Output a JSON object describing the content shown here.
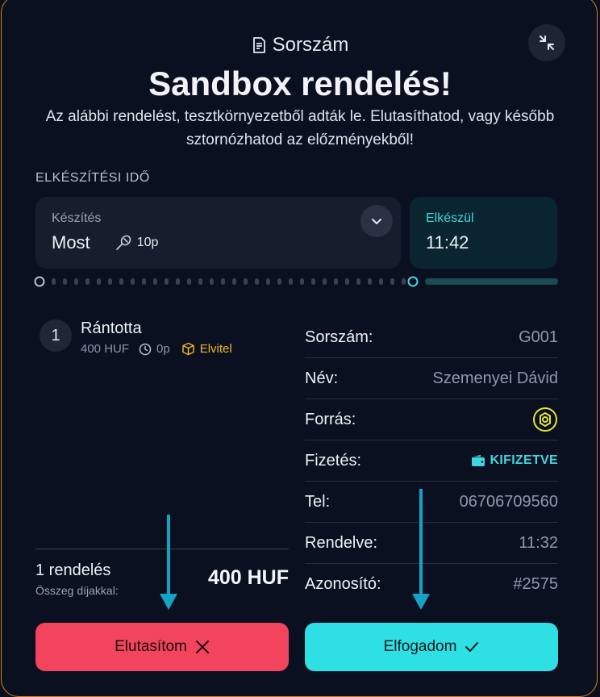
{
  "header": {
    "label": "Sorszám",
    "title": "Sandbox rendelés!",
    "subtitle": "Az alábbi rendelést, tesztkörnyezetből adták le. Elutasíthatod, vagy később sztornózhatod az előzményekből!"
  },
  "prep": {
    "section_label": "ELKÉSZÍTÉSI IDŐ",
    "caption": "Készítés",
    "value": "Most",
    "duration": "10p",
    "ready_caption": "Elkészül",
    "ready_value": "11:42"
  },
  "order": {
    "items": [
      {
        "qty": "1",
        "name": "Rántotta",
        "price": "400 HUF",
        "time": "0p",
        "mode": "Elvitel"
      }
    ],
    "count": "1 rendelés",
    "sum_caption": "Összeg díjakkal:",
    "total": "400 HUF"
  },
  "info": {
    "rows": [
      {
        "label": "Sorszám:",
        "value": "G001"
      },
      {
        "label": "Név:",
        "value": "Szemenyei Dávid"
      },
      {
        "label": "Forrás:",
        "value": ""
      },
      {
        "label": "Fizetés:",
        "value": "KIFIZETVE"
      },
      {
        "label": "Tel:",
        "value": "06706709560"
      },
      {
        "label": "Rendelve:",
        "value": "11:32"
      },
      {
        "label": "Azonosító:",
        "value": "#2575"
      }
    ]
  },
  "actions": {
    "reject_label": "Elutasítom",
    "accept_label": "Elfogadom"
  },
  "colors": {
    "accent_cyan": "#2ee0e4",
    "reject_red": "#f2455d",
    "takeaway_yellow": "#f0b429",
    "border_orange": "#d9801f"
  },
  "icons": {
    "header": "receipt-icon",
    "collapse": "collapse-icon",
    "dropdown": "chevron-down-icon",
    "duration": "whisk-icon",
    "time": "clock-icon",
    "takeaway": "box-icon",
    "source": "source-logo-icon",
    "paid": "wallet-icon",
    "reject": "close-icon",
    "accept": "check-icon"
  }
}
